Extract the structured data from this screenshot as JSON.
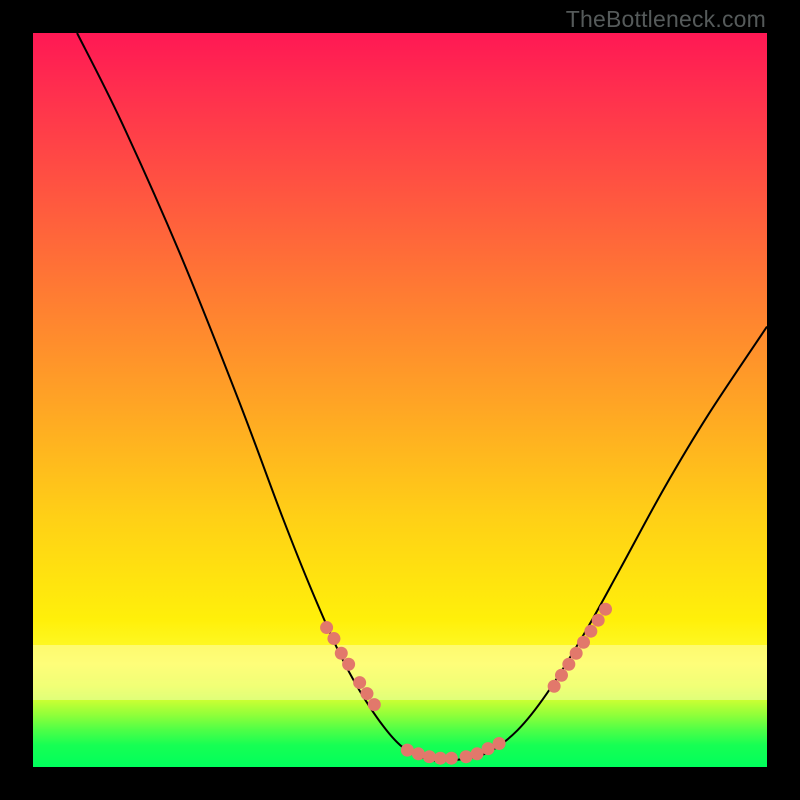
{
  "watermark": "TheBottleneck.com",
  "colors": {
    "background": "#000000",
    "gradient_top": "#ff1854",
    "gradient_mid1": "#ffa325",
    "gradient_mid2": "#fff00a",
    "gradient_bottom": "#00ff5c",
    "curve": "#000000",
    "marker": "#e2786b"
  },
  "chart_data": {
    "type": "line",
    "title": "",
    "xlabel": "",
    "ylabel": "",
    "xlim": [
      0,
      100
    ],
    "ylim": [
      0,
      100
    ],
    "curve": {
      "comment": "V-shaped bottleneck curve; y is percentage height from bottom, x is percentage across",
      "points": [
        {
          "x": 6,
          "y": 100
        },
        {
          "x": 12,
          "y": 88
        },
        {
          "x": 20,
          "y": 70
        },
        {
          "x": 28,
          "y": 50
        },
        {
          "x": 34,
          "y": 34
        },
        {
          "x": 38,
          "y": 24
        },
        {
          "x": 42,
          "y": 15
        },
        {
          "x": 46,
          "y": 8
        },
        {
          "x": 50,
          "y": 3
        },
        {
          "x": 54,
          "y": 1
        },
        {
          "x": 58,
          "y": 1
        },
        {
          "x": 62,
          "y": 2
        },
        {
          "x": 66,
          "y": 5
        },
        {
          "x": 70,
          "y": 10
        },
        {
          "x": 75,
          "y": 18
        },
        {
          "x": 80,
          "y": 27
        },
        {
          "x": 86,
          "y": 38
        },
        {
          "x": 92,
          "y": 48
        },
        {
          "x": 100,
          "y": 60
        }
      ]
    },
    "markers": {
      "comment": "salmon dotted segments on the curve near the trough and partway up each arm",
      "left_arm": [
        {
          "x": 40,
          "y": 19
        },
        {
          "x": 41,
          "y": 17.5
        },
        {
          "x": 42,
          "y": 15.5
        },
        {
          "x": 43,
          "y": 14
        },
        {
          "x": 44.5,
          "y": 11.5
        },
        {
          "x": 45.5,
          "y": 10
        },
        {
          "x": 46.5,
          "y": 8.5
        }
      ],
      "trough": [
        {
          "x": 51,
          "y": 2.3
        },
        {
          "x": 52.5,
          "y": 1.8
        },
        {
          "x": 54,
          "y": 1.4
        },
        {
          "x": 55.5,
          "y": 1.2
        },
        {
          "x": 57,
          "y": 1.2
        },
        {
          "x": 59,
          "y": 1.4
        },
        {
          "x": 60.5,
          "y": 1.8
        },
        {
          "x": 62,
          "y": 2.5
        },
        {
          "x": 63.5,
          "y": 3.2
        }
      ],
      "right_arm": [
        {
          "x": 71,
          "y": 11
        },
        {
          "x": 72,
          "y": 12.5
        },
        {
          "x": 73,
          "y": 14
        },
        {
          "x": 74,
          "y": 15.5
        },
        {
          "x": 75,
          "y": 17
        },
        {
          "x": 76,
          "y": 18.5
        },
        {
          "x": 77,
          "y": 20
        },
        {
          "x": 78,
          "y": 21.5
        }
      ]
    }
  }
}
